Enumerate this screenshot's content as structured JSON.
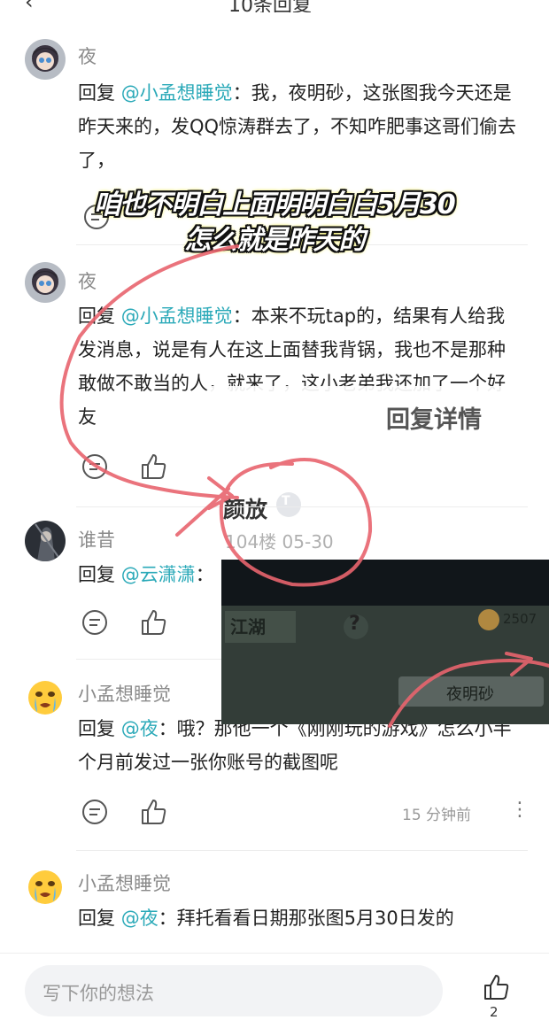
{
  "header": {
    "back": "‹",
    "title": "10条回复"
  },
  "comments": [
    {
      "author": "夜",
      "prefix": "回复 ",
      "mention": "@小孟想睡觉",
      "text": "：我，夜明砂，这张图我今天还是昨天来的，发QQ惊涛群去了，不知咋肥事这哥们偷去了，",
      "avatar": "game-character-avatar"
    },
    {
      "author": "夜",
      "prefix": "回复 ",
      "mention": "@小孟想睡觉",
      "text": "：本来不玩tap的，结果有人给我发消息，说是有人在这上面替我背锅，我也不是那种敢做不敢当的人，就来了，这小老弟我还加了一个好友",
      "avatar": "game-character-avatar"
    },
    {
      "author": "谁昔",
      "prefix": "回复 ",
      "mention": "@云潇潇",
      "text": "：",
      "avatar": "dark-character-avatar"
    },
    {
      "author": "小孟想睡觉",
      "prefix": "回复 ",
      "mention": "@夜",
      "text": "：哦？那他一个《刚刚玩的游戏》怎么小半个月前发过一张你账号的截图呢",
      "time": "15 分钟前",
      "avatar": "crying-emoji-avatar"
    },
    {
      "author": "小孟想睡觉",
      "prefix": "回复 ",
      "mention": "@夜",
      "text": "：拜托看看日期那张图5月30日发的",
      "avatar": "crying-emoji-avatar"
    }
  ],
  "caption": {
    "line1": "咱也不明白上面明明白白5月30",
    "line2": "怎么就是昨天的"
  },
  "reply_detail": {
    "title": "回复详情",
    "name": "颜放",
    "badge": "T",
    "meta": "104楼  05-30"
  },
  "game_screenshot": {
    "left_label": "江湖",
    "question": "?",
    "coins": "2507",
    "player_name": "夜明砂"
  },
  "footer": {
    "placeholder": "写下你的想法",
    "like_count": "2"
  },
  "colors": {
    "mention": "#2aa9b8",
    "annotation": "#e8646e",
    "caption_glow": "#e8e000"
  }
}
